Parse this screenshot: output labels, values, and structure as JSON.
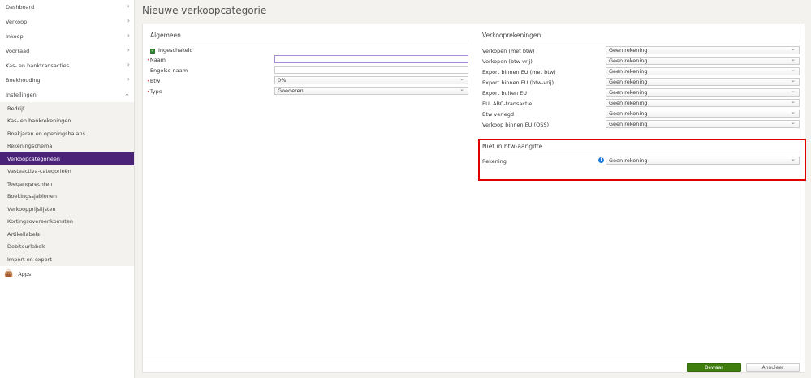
{
  "sidebar": {
    "items": [
      {
        "label": "Dashboard"
      },
      {
        "label": "Verkoop"
      },
      {
        "label": "Inkoop"
      },
      {
        "label": "Voorraad"
      },
      {
        "label": "Kas- en banktransacties"
      },
      {
        "label": "Boekhouding"
      },
      {
        "label": "Instellingen"
      }
    ],
    "subitems": [
      {
        "label": "Bedrijf"
      },
      {
        "label": "Kas- en bankrekeningen"
      },
      {
        "label": "Boekjaren en openingsbalans"
      },
      {
        "label": "Rekeningschema"
      },
      {
        "label": "Verkoopcategorieën"
      },
      {
        "label": "Vasteactiva-categorieën"
      },
      {
        "label": "Toegangsrechten"
      },
      {
        "label": "Boekingssjablonen"
      },
      {
        "label": "Verkoopprijslijsten"
      },
      {
        "label": "Kortingsovereenkomsten"
      },
      {
        "label": "Artikellabels"
      },
      {
        "label": "Debiteurlabels"
      },
      {
        "label": "Import en export"
      }
    ],
    "active": "Verkoopcategorieën",
    "apps": "Apps"
  },
  "page": {
    "title": "Nieuwe verkoopcategorie"
  },
  "algemeen": {
    "title": "Algemeen",
    "enabled_label": "Ingeschakeld",
    "enabled": true,
    "naam_label": "Naam",
    "naam_value": "",
    "engelse_label": "Engelse naam",
    "engelse_value": "",
    "btw_label": "Btw",
    "btw_value": "0%",
    "type_label": "Type",
    "type_value": "Goederen"
  },
  "verkooprekeningen": {
    "title": "Verkooprekeningen",
    "rows": [
      {
        "label": "Verkopen (met btw)",
        "value": "Geen rekening"
      },
      {
        "label": "Verkopen (btw-vrij)",
        "value": "Geen rekening"
      },
      {
        "label": "Export binnen EU (met btw)",
        "value": "Geen rekening"
      },
      {
        "label": "Export binnen EU (btw-vrij)",
        "value": "Geen rekening"
      },
      {
        "label": "Export buiten EU",
        "value": "Geen rekening"
      },
      {
        "label": "EU, ABC-transactie",
        "value": "Geen rekening"
      },
      {
        "label": "Btw verlegd",
        "value": "Geen rekening"
      },
      {
        "label": "Verkoop binnen EU (OSS)",
        "value": "Geen rekening"
      }
    ]
  },
  "niet_in_btw": {
    "title": "Niet in btw-aangifte",
    "label": "Rekening",
    "value": "Geen rekening"
  },
  "footer": {
    "save": "Bewaar",
    "cancel": "Annuleer"
  },
  "colors": {
    "accent": "#4a2278",
    "save": "#3f7d0f",
    "highlight": "#e00000",
    "info": "#1e7ad6"
  }
}
